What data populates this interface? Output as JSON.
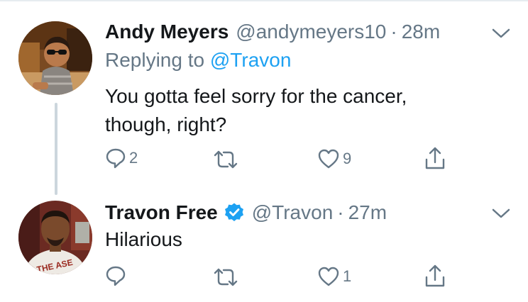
{
  "tweets": [
    {
      "display_name": "Andy Meyers",
      "handle": "@andymeyers10",
      "separator": "·",
      "time": "28m",
      "reply_prefix": "Replying to",
      "reply_mention": "@Travon",
      "text_line1": "You gotta feel sorry for the cancer,",
      "text_line2": "though, right?",
      "reply_count": "2",
      "retweet_count": "",
      "like_count": "9",
      "icons": [
        "reply-icon",
        "retweet-icon",
        "like-icon",
        "share-icon",
        "chevron-down-icon"
      ]
    },
    {
      "display_name": "Travon Free",
      "handle": "@Travon",
      "separator": "·",
      "time": "27m",
      "verified": true,
      "text_line1": "Hilarious",
      "reply_count": "",
      "retweet_count": "",
      "like_count": "1",
      "avatar_shirt_text": "THE ASE",
      "icons": [
        "verified-badge-icon",
        "reply-icon",
        "retweet-icon",
        "like-icon",
        "share-icon",
        "chevron-down-icon"
      ]
    }
  ],
  "colors": {
    "text": "#14171a",
    "muted": "#657786",
    "link": "#1da1f2",
    "verified": "#1da1f2",
    "thread_line": "#ccd6dd",
    "divider": "#e6ecf0"
  }
}
